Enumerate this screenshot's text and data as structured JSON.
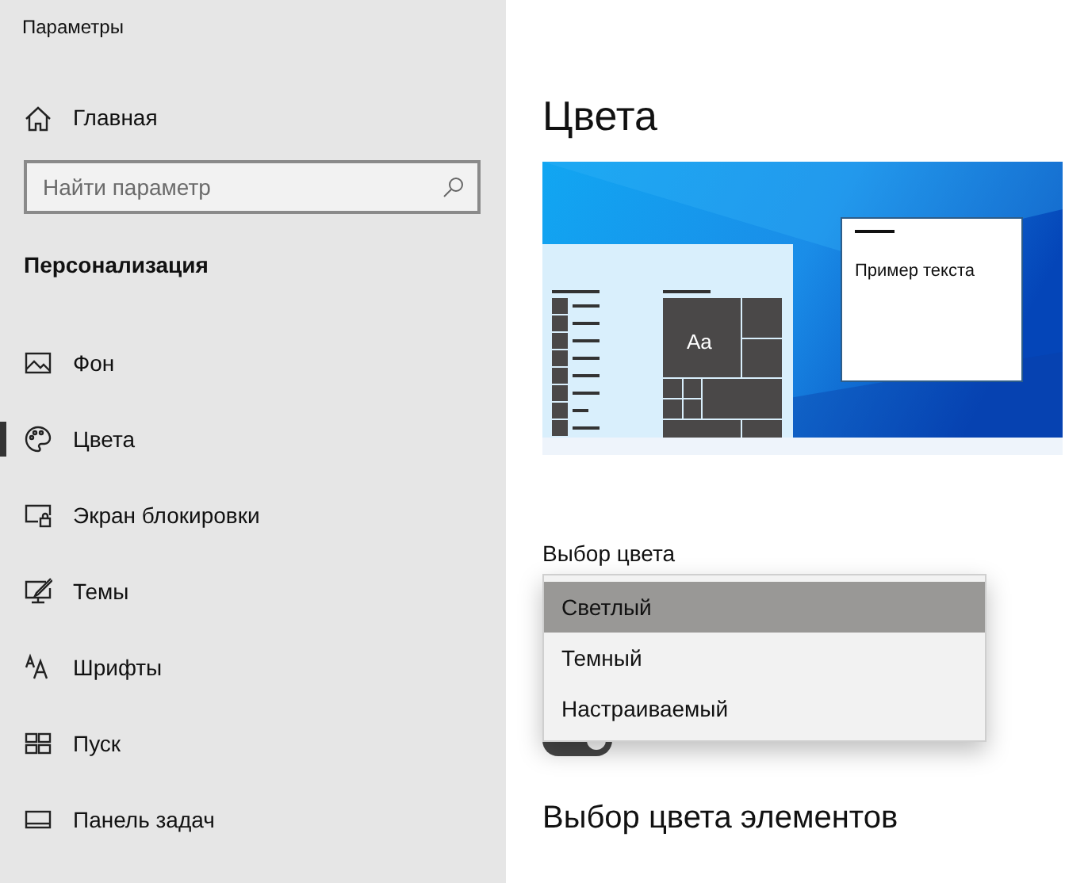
{
  "window": {
    "title": "Параметры"
  },
  "sidebar": {
    "home": {
      "label": "Главная"
    },
    "search": {
      "placeholder": "Найти параметр"
    },
    "section": "Персонализация",
    "items": [
      {
        "label": "Фон",
        "kind": "picture",
        "selected": false
      },
      {
        "label": "Цвета",
        "kind": "palette",
        "selected": true
      },
      {
        "label": "Экран блокировки",
        "kind": "lock",
        "selected": false
      },
      {
        "label": "Темы",
        "kind": "themes",
        "selected": false
      },
      {
        "label": "Шрифты",
        "kind": "fonts",
        "selected": false
      },
      {
        "label": "Пуск",
        "kind": "start",
        "selected": false
      },
      {
        "label": "Панель задач",
        "kind": "taskbar",
        "selected": false
      }
    ]
  },
  "page": {
    "title": "Цвета",
    "preview": {
      "tile_text": "Aa",
      "sample_text": "Пример текста"
    },
    "color_choice": {
      "label": "Выбор цвета",
      "options": [
        {
          "label": "Светлый",
          "selected": true
        },
        {
          "label": "Темный",
          "selected": false
        },
        {
          "label": "Настраиваемый",
          "selected": false
        }
      ]
    },
    "toggle": {
      "on": true
    },
    "accent_heading": "Выбор цвета элементов"
  }
}
